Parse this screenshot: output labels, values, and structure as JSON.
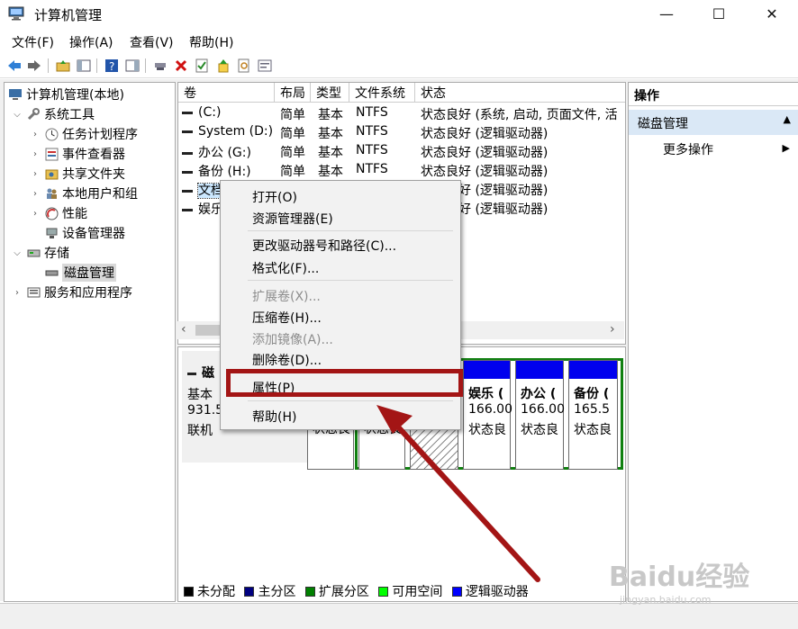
{
  "window": {
    "title": "计算机管理",
    "minimize_glyph": "—",
    "maximize_glyph": "☐",
    "close_glyph": "✕"
  },
  "menu": [
    "文件(F)",
    "操作(A)",
    "查看(V)",
    "帮助(H)"
  ],
  "toolbar": {
    "icons": [
      "back-icon",
      "forward-icon",
      "up-folder-icon",
      "show-hide-tree-icon",
      "help-icon",
      "properties-pane-icon",
      "connect-icon",
      "delete-icon",
      "check-icon",
      "export-icon",
      "search-icon",
      "settings-icon"
    ]
  },
  "tree": {
    "root": "计算机管理(本地)",
    "items": [
      {
        "label": "系统工具",
        "level": 1,
        "expanded": true,
        "icon": "tools-icon"
      },
      {
        "label": "任务计划程序",
        "level": 2,
        "icon": "clock-icon"
      },
      {
        "label": "事件查看器",
        "level": 2,
        "icon": "event-viewer-icon"
      },
      {
        "label": "共享文件夹",
        "level": 2,
        "icon": "shared-folder-icon"
      },
      {
        "label": "本地用户和组",
        "level": 2,
        "icon": "users-icon"
      },
      {
        "label": "性能",
        "level": 2,
        "icon": "performance-icon"
      },
      {
        "label": "设备管理器",
        "level": 2,
        "icon": "device-manager-icon"
      },
      {
        "label": "存储",
        "level": 1,
        "expanded": true,
        "icon": "storage-icon"
      },
      {
        "label": "磁盘管理",
        "level": 2,
        "selected": true,
        "icon": "disk-icon"
      },
      {
        "label": "服务和应用程序",
        "level": 1,
        "expanded": false,
        "icon": "services-icon"
      }
    ]
  },
  "volumes": {
    "columns": [
      "卷",
      "布局",
      "类型",
      "文件系统",
      "状态"
    ],
    "rows": [
      {
        "name": "(C:)",
        "layout": "简单",
        "type": "基本",
        "fs": "NTFS",
        "status": "状态良好 (系统, 启动, 页面文件, 活"
      },
      {
        "name": "System (D:)",
        "layout": "简单",
        "type": "基本",
        "fs": "NTFS",
        "status": "状态良好 (逻辑驱动器)"
      },
      {
        "name": "办公 (G:)",
        "layout": "简单",
        "type": "基本",
        "fs": "NTFS",
        "status": "状态良好 (逻辑驱动器)"
      },
      {
        "name": "备份 (H:)",
        "layout": "简单",
        "type": "基本",
        "fs": "NTFS",
        "status": "状态良好 (逻辑驱动器)"
      },
      {
        "name": "文档",
        "layout": "",
        "type": "",
        "fs": "",
        "status": "状态良好 (逻辑驱动器)",
        "selected": true
      },
      {
        "name": "娱乐",
        "layout": "",
        "type": "",
        "fs": "",
        "status": "状态良好 (逻辑驱动器)"
      }
    ]
  },
  "disk": {
    "label": "磁",
    "type": "基本",
    "size": "931.5",
    "state": "联机",
    "partitions": [
      {
        "name": "",
        "size": "",
        "status": "状态良"
      },
      {
        "name": "",
        "size": "",
        "status": "状态良"
      },
      {
        "name": "",
        "size": "",
        "status": ""
      },
      {
        "name": "娱乐 (",
        "size": "166.00",
        "status": "状态良"
      },
      {
        "name": "办公 (",
        "size": "166.00",
        "status": "状态良"
      },
      {
        "name": "备份 (",
        "size": "165.5",
        "status": "状态良"
      }
    ]
  },
  "legend": [
    {
      "label": "未分配",
      "color": "#000000"
    },
    {
      "label": "主分区",
      "color": "#000080"
    },
    {
      "label": "扩展分区",
      "color": "#008000"
    },
    {
      "label": "可用空间",
      "color": "#00ff00"
    },
    {
      "label": "逻辑驱动器",
      "color": "#0000ff"
    }
  ],
  "actions": {
    "header": "操作",
    "section": "磁盘管理",
    "item": "更多操作"
  },
  "context_menu": {
    "items": [
      {
        "label": "打开(O)",
        "enabled": true
      },
      {
        "label": "资源管理器(E)",
        "enabled": true
      },
      {
        "label": "更改驱动器号和路径(C)...",
        "enabled": true
      },
      {
        "label": "格式化(F)...",
        "enabled": true
      },
      {
        "label": "扩展卷(X)...",
        "enabled": false
      },
      {
        "label": "压缩卷(H)...",
        "enabled": true
      },
      {
        "label": "添加镜像(A)...",
        "enabled": false
      },
      {
        "label": "删除卷(D)...",
        "enabled": true
      },
      {
        "label": "属性(P)",
        "enabled": true,
        "highlighted": true
      },
      {
        "label": "帮助(H)",
        "enabled": true
      }
    ]
  },
  "watermark": {
    "line1": "Baidu经验",
    "line2": "jingyan.baidu.com"
  },
  "colors": {
    "accent_header": "#dae8f6",
    "highlight_box": "#a31515",
    "selection": "#cce8ff",
    "logical_drive": "#0000ee",
    "extended": "#008000"
  }
}
